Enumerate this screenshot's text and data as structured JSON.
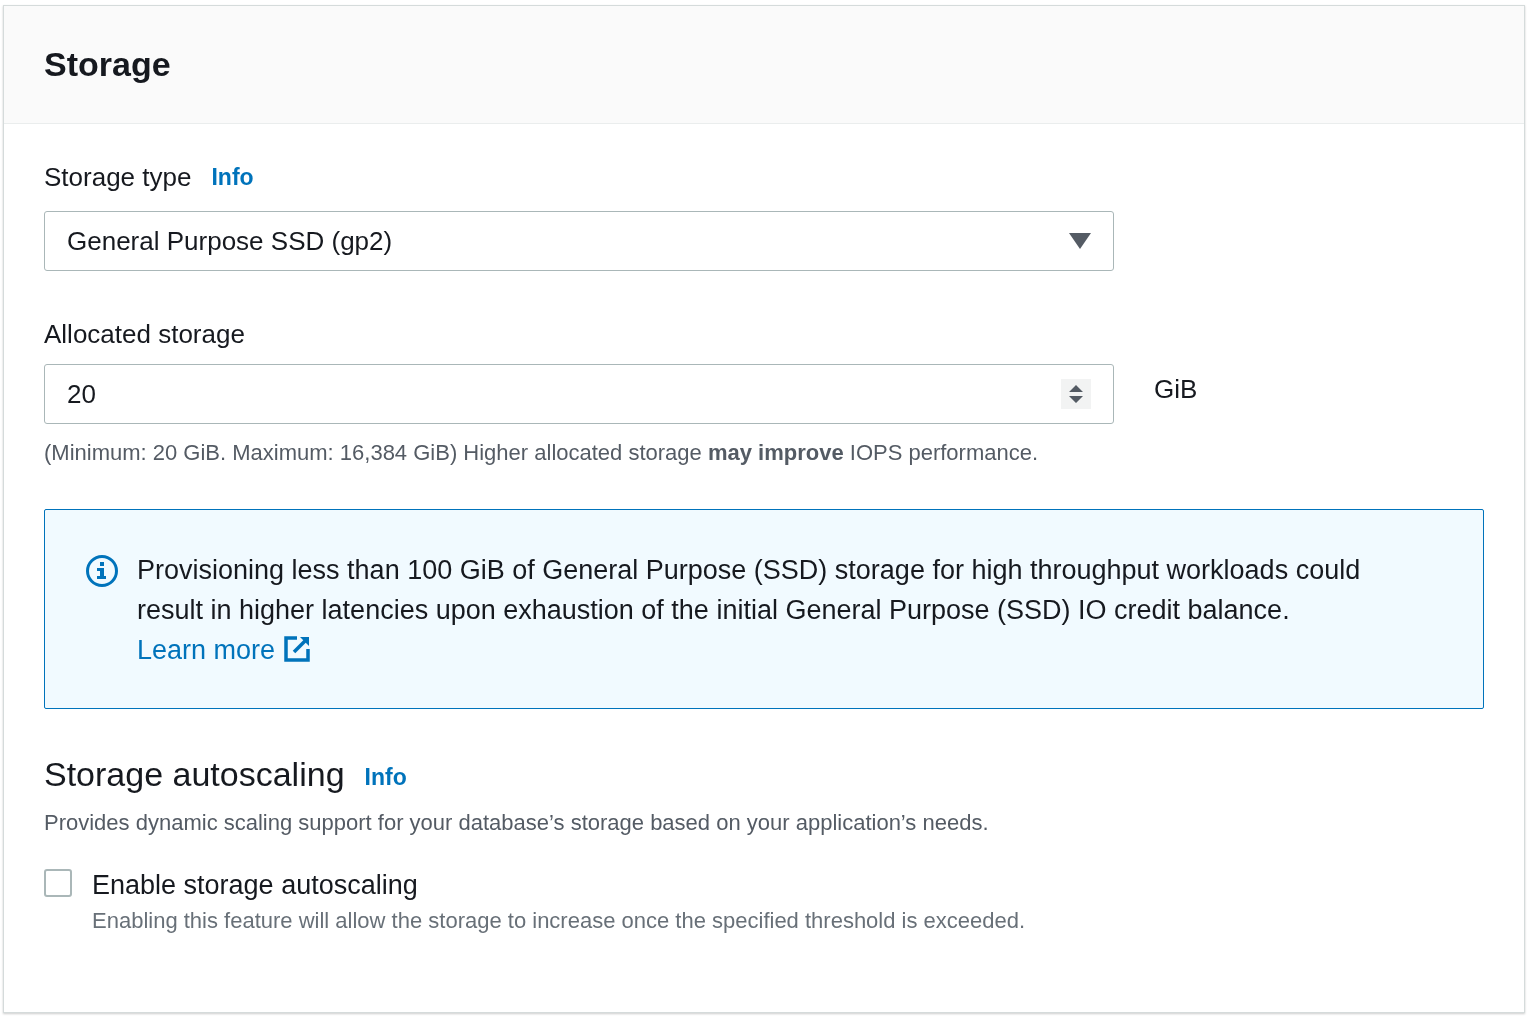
{
  "panel": {
    "title": "Storage"
  },
  "storage_type": {
    "label": "Storage type",
    "info": "Info",
    "value": "General Purpose SSD (gp2)"
  },
  "allocated_storage": {
    "label": "Allocated storage",
    "value": "20",
    "unit": "GiB",
    "hint": "(Minimum: 20 GiB. Maximum: 16,384 GiB) Higher allocated storage **may improve** IOPS performance."
  },
  "alert": {
    "text": "Provisioning less than 100 GiB of General Purpose (SSD) storage for high throughput workloads could result in higher latencies upon exhaustion of the initial General Purpose (SSD) IO credit balance.",
    "link": "Learn more"
  },
  "autoscaling": {
    "title": "Storage autoscaling",
    "info": "Info",
    "description": "Provides dynamic scaling support for your database’s storage based on your application’s needs.",
    "checkbox": {
      "label": "Enable storage autoscaling",
      "checked": false,
      "description": "Enabling this feature will allow the storage to increase once the specified threshold is exceeded."
    }
  }
}
